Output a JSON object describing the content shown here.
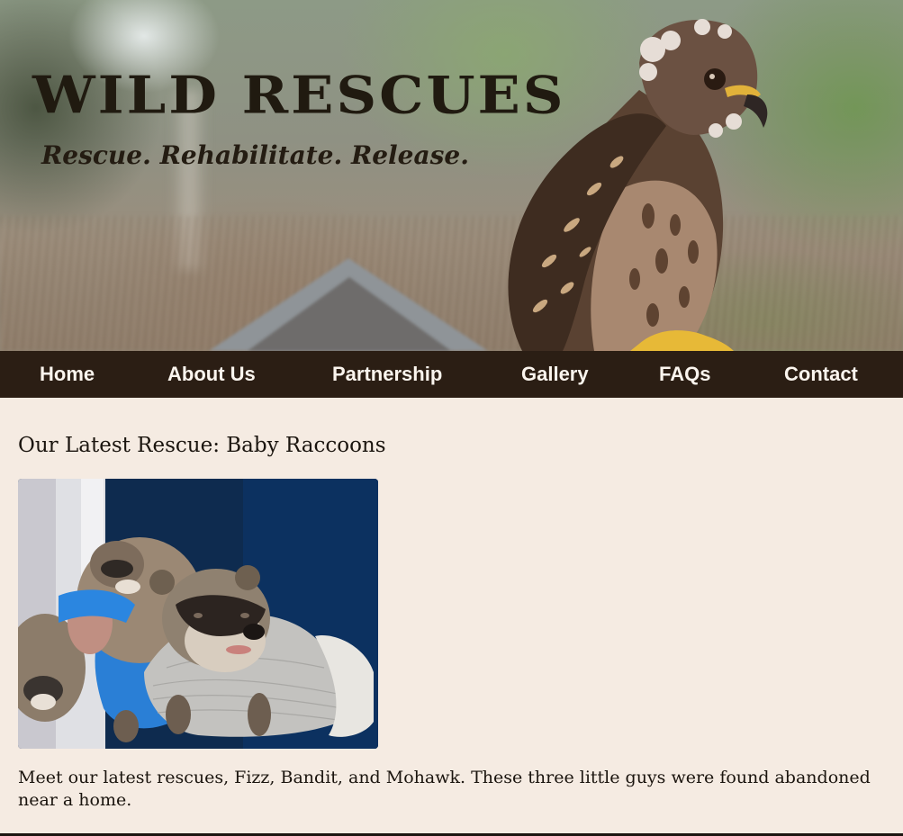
{
  "header": {
    "site_title": "WILD RESCUES",
    "tagline": "Rescue. Rehabilitate. Release."
  },
  "nav": {
    "items": [
      {
        "label": "Home"
      },
      {
        "label": "About Us"
      },
      {
        "label": "Partnership"
      },
      {
        "label": "Gallery"
      },
      {
        "label": "FAQs"
      },
      {
        "label": "Contact"
      }
    ]
  },
  "main": {
    "heading": "Our Latest Rescue: Baby Raccoons",
    "body": "Meet our latest rescues, Fizz, Bandit, and Mohawk. These three little guys were found abandoned near a home."
  },
  "colors": {
    "nav_background": "#2b1e14",
    "page_background": "#f5ebe2",
    "nav_text": "#fbf5ee"
  }
}
